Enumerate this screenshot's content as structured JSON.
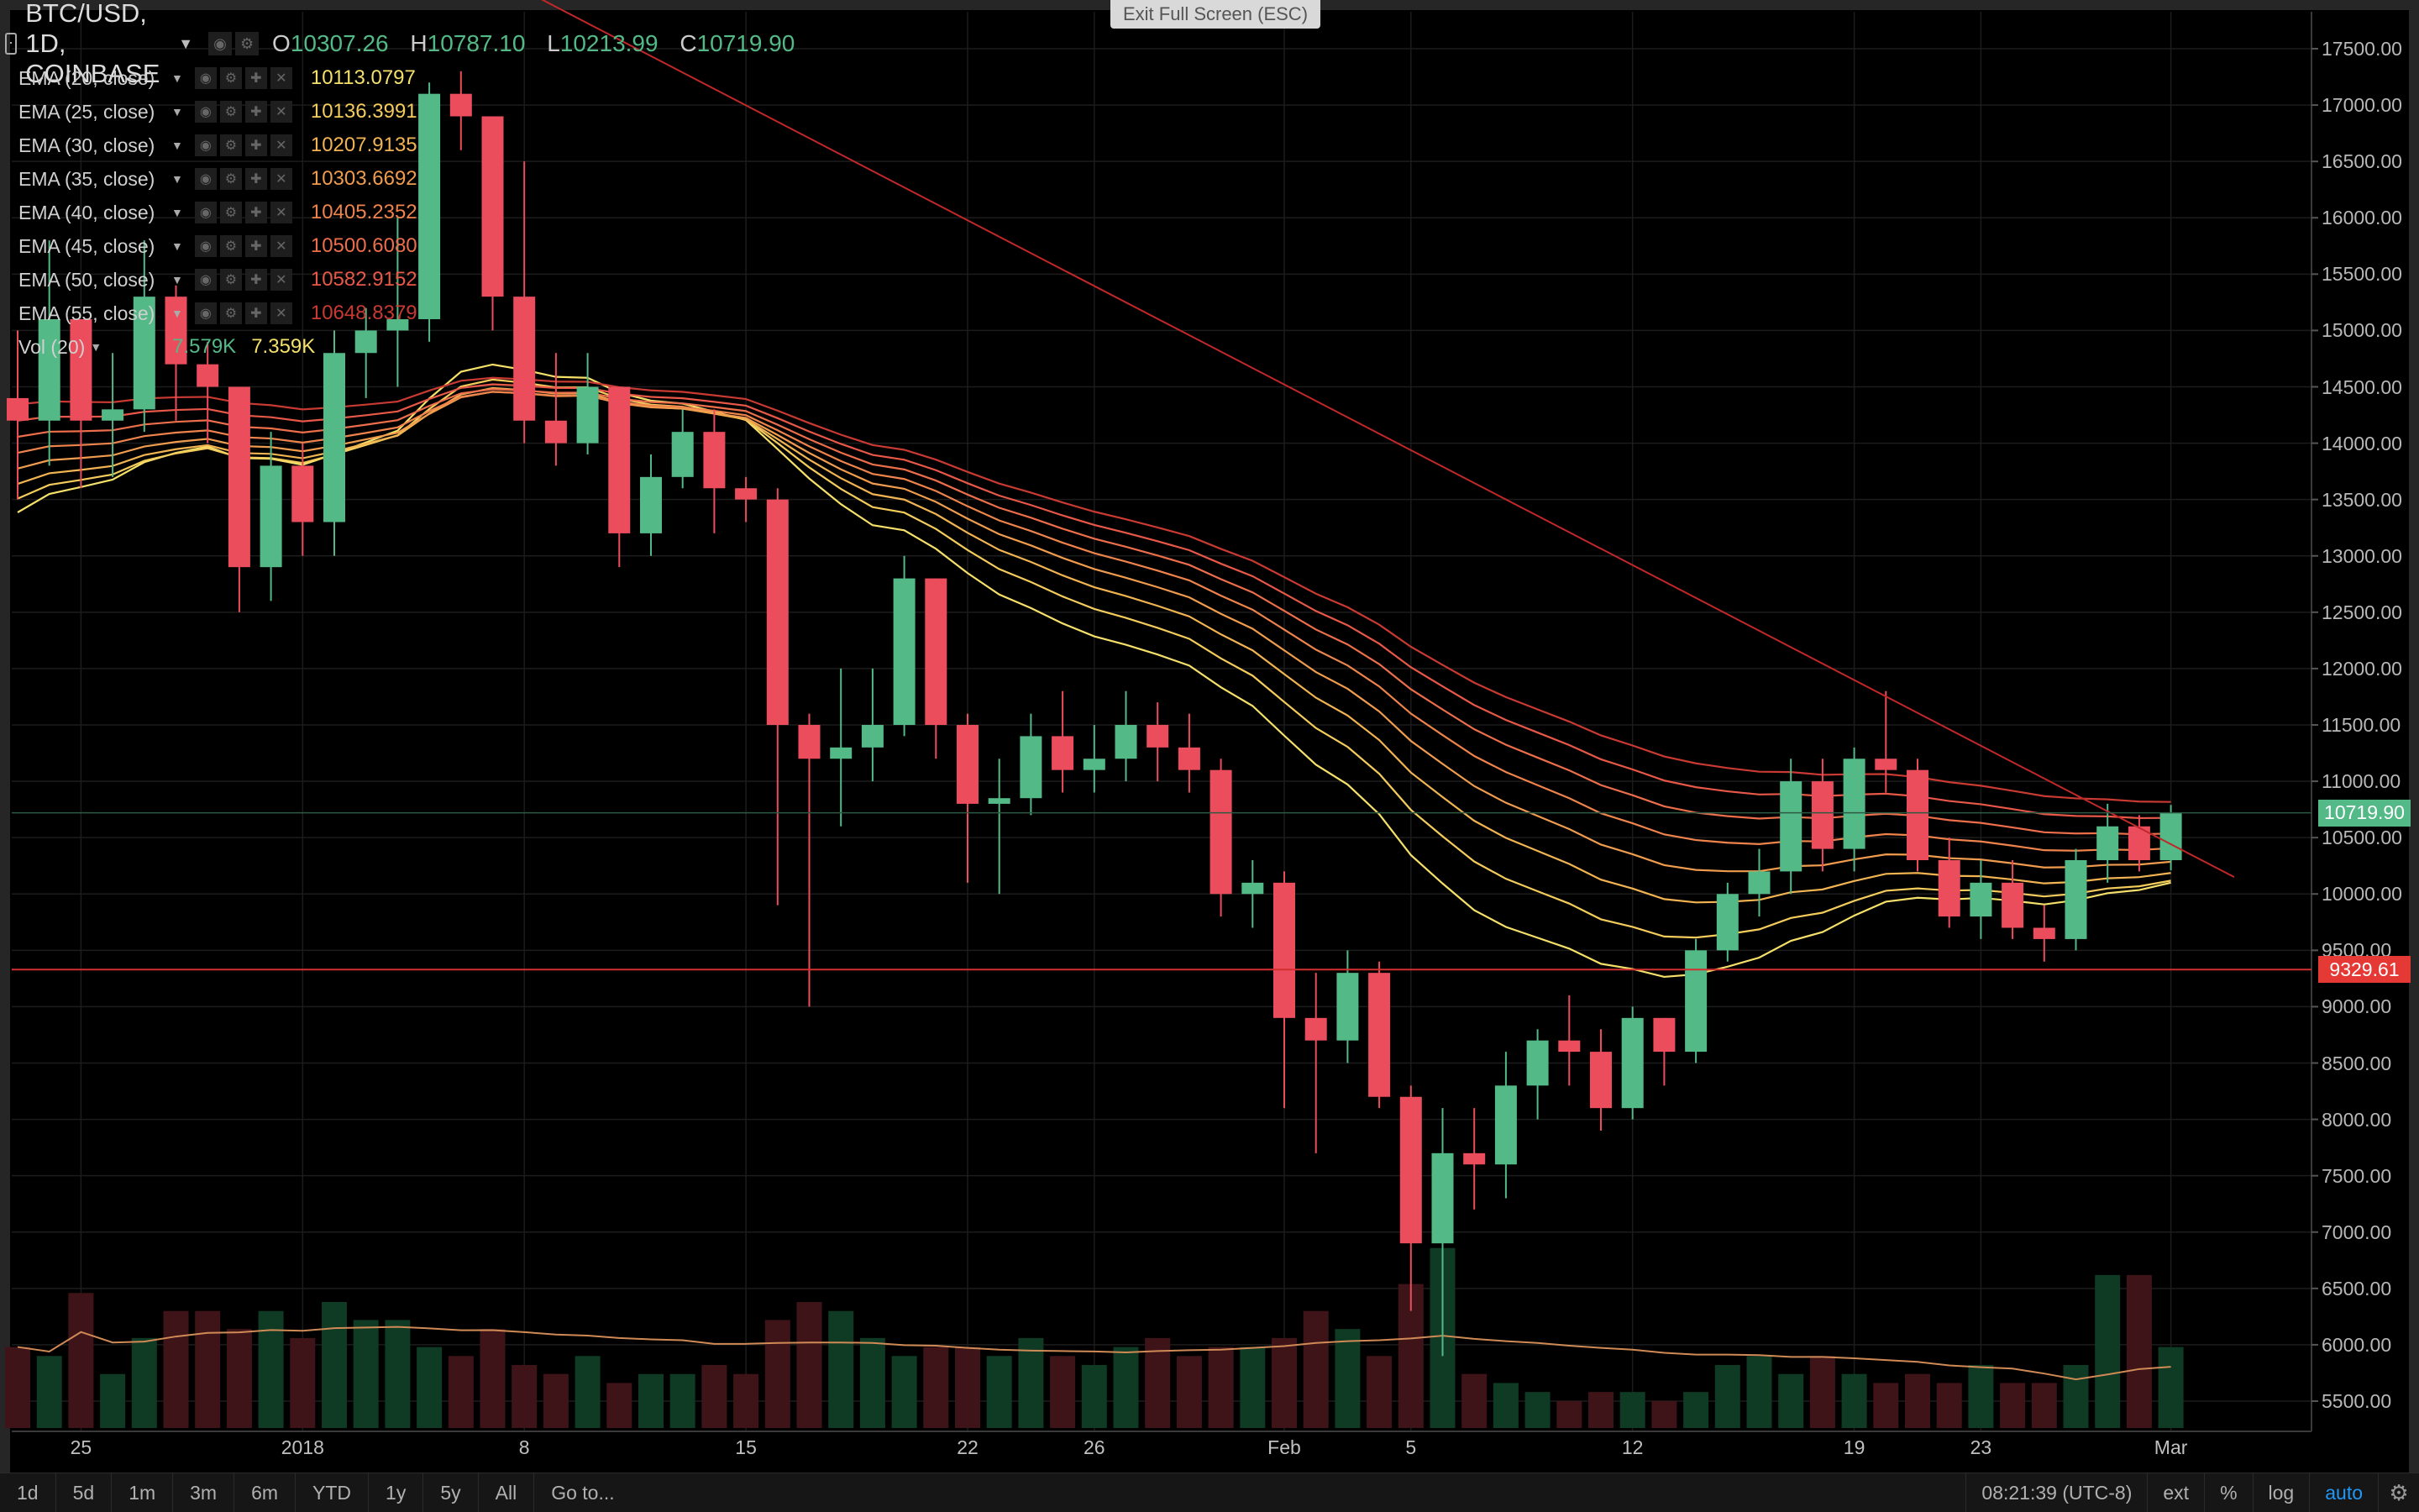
{
  "header": {
    "symbol": "BTC/USD, 1D, COINBASE",
    "ohlc": {
      "o_label": "O",
      "o": "10307.26",
      "h_label": "H",
      "h": "10787.10",
      "l_label": "L",
      "l": "10213.99",
      "c_label": "C",
      "c": "10719.90"
    }
  },
  "exit_fullscreen": "Exit Full Screen (ESC)",
  "indicators": [
    {
      "name": "EMA (20, close)",
      "value": "10113.0797",
      "color": "#f5e06a"
    },
    {
      "name": "EMA (25, close)",
      "value": "10136.3991",
      "color": "#f4cc5c"
    },
    {
      "name": "EMA (30, close)",
      "value": "10207.9135",
      "color": "#f2b452"
    },
    {
      "name": "EMA (35, close)",
      "value": "10303.6692",
      "color": "#f09c4e"
    },
    {
      "name": "EMA (40, close)",
      "value": "10405.2352",
      "color": "#ee844c"
    },
    {
      "name": "EMA (45, close)",
      "value": "10500.6080",
      "color": "#ec6e4b"
    },
    {
      "name": "EMA (50, close)",
      "value": "10582.9152",
      "color": "#e85848"
    },
    {
      "name": "EMA (55, close)",
      "value": "10648.8379",
      "color": "#c83a32"
    }
  ],
  "volume": {
    "name": "Vol (20)",
    "v1": "7.579K",
    "v2": "7.359K",
    "v1_color": "#53b987",
    "v2_color": "#f5e06a"
  },
  "price_axis": {
    "labels": [
      "17500.00",
      "17000.00",
      "16500.00",
      "16000.00",
      "15500.00",
      "15000.00",
      "14500.00",
      "14000.00",
      "13500.00",
      "13000.00",
      "12500.00",
      "12000.00",
      "11500.00",
      "11000.00",
      "10500.00",
      "10000.00",
      "9500.00",
      "9000.00",
      "8500.00",
      "8000.00",
      "7500.00",
      "7000.00",
      "6500.00",
      "6000.00",
      "5500.00"
    ],
    "last_price": "10719.90",
    "marker_price": "9329.61"
  },
  "time_axis": {
    "labels": [
      {
        "text": "25",
        "bar": 2
      },
      {
        "text": "2018",
        "bar": 9
      },
      {
        "text": "8",
        "bar": 16
      },
      {
        "text": "15",
        "bar": 23
      },
      {
        "text": "22",
        "bar": 30
      },
      {
        "text": "26",
        "bar": 34
      },
      {
        "text": "Feb",
        "bar": 40
      },
      {
        "text": "5",
        "bar": 44
      },
      {
        "text": "12",
        "bar": 51
      },
      {
        "text": "19",
        "bar": 58
      },
      {
        "text": "23",
        "bar": 62
      },
      {
        "text": "Mar",
        "bar": 68
      }
    ]
  },
  "bottom_bar": {
    "timeframes": [
      "1d",
      "5d",
      "1m",
      "3m",
      "6m",
      "YTD",
      "1y",
      "5y",
      "All"
    ],
    "goto": "Go to...",
    "time": "08:21:39 (UTC-8)",
    "ext": "ext",
    "percent": "%",
    "log": "log",
    "auto": "auto"
  },
  "colors": {
    "up": "#53b987",
    "down": "#eb4d5c",
    "trendline": "#c0282a",
    "support": "#d32f2f",
    "last_price_tag": "#53b987",
    "marker_tag": "#e53935",
    "grid": "#1c1c1c"
  },
  "chart_data": {
    "type": "candlestick",
    "price_range": [
      5000,
      17800
    ],
    "candles": [
      [
        14400,
        14200,
        15000,
        13500
      ],
      [
        14200,
        15100,
        15800,
        13800
      ],
      [
        15100,
        14200,
        14600,
        13600
      ],
      [
        14200,
        14300,
        14800,
        13700
      ],
      [
        14300,
        15300,
        15800,
        14100
      ],
      [
        15300,
        14700,
        15400,
        14200
      ],
      [
        14700,
        14500,
        14900,
        14000
      ],
      [
        14500,
        12900,
        14500,
        12500
      ],
      [
        12900,
        13800,
        14100,
        12600
      ],
      [
        13800,
        13300,
        14000,
        13000
      ],
      [
        13300,
        14800,
        15000,
        13000
      ],
      [
        14800,
        15000,
        15200,
        14400
      ],
      [
        15000,
        15100,
        16000,
        14500
      ],
      [
        15100,
        17100,
        17200,
        14900
      ],
      [
        17100,
        16900,
        17300,
        16600
      ],
      [
        16900,
        15300,
        16900,
        15000
      ],
      [
        15300,
        14200,
        16500,
        14000
      ],
      [
        14200,
        14000,
        14800,
        13800
      ],
      [
        14000,
        14500,
        14800,
        13900
      ],
      [
        14500,
        13200,
        14500,
        12900
      ],
      [
        13200,
        13700,
        13900,
        13000
      ],
      [
        13700,
        14100,
        14300,
        13600
      ],
      [
        14100,
        13600,
        14300,
        13200
      ],
      [
        13600,
        13500,
        13700,
        13300
      ],
      [
        13500,
        11500,
        13600,
        9900
      ],
      [
        11500,
        11200,
        11600,
        9000
      ],
      [
        11200,
        11300,
        12000,
        10600
      ],
      [
        11300,
        11500,
        12000,
        11000
      ],
      [
        11500,
        12800,
        13000,
        11400
      ],
      [
        12800,
        11500,
        12800,
        11200
      ],
      [
        11500,
        10800,
        11600,
        10100
      ],
      [
        10800,
        10850,
        11200,
        10000
      ],
      [
        10850,
        11400,
        11600,
        10700
      ],
      [
        11400,
        11100,
        11800,
        10900
      ],
      [
        11100,
        11200,
        11500,
        10900
      ],
      [
        11200,
        11500,
        11800,
        11000
      ],
      [
        11500,
        11300,
        11700,
        11000
      ],
      [
        11300,
        11100,
        11600,
        10900
      ],
      [
        11100,
        10000,
        11200,
        9800
      ],
      [
        10000,
        10100,
        10300,
        9700
      ],
      [
        10100,
        8900,
        10200,
        8100
      ],
      [
        8900,
        8700,
        9300,
        7700
      ],
      [
        8700,
        9300,
        9500,
        8500
      ],
      [
        9300,
        8200,
        9400,
        8100
      ],
      [
        8200,
        6900,
        8300,
        6300
      ],
      [
        6900,
        7700,
        8100,
        5900
      ],
      [
        7700,
        7600,
        8100,
        7200
      ],
      [
        7600,
        8300,
        8600,
        7300
      ],
      [
        8300,
        8700,
        8800,
        8000
      ],
      [
        8700,
        8600,
        9100,
        8300
      ],
      [
        8600,
        8100,
        8800,
        7900
      ],
      [
        8100,
        8900,
        9000,
        8000
      ],
      [
        8900,
        8600,
        8900,
        8300
      ],
      [
        8600,
        9500,
        9600,
        8500
      ],
      [
        9500,
        10000,
        10100,
        9400
      ],
      [
        10000,
        10200,
        10400,
        9800
      ],
      [
        10200,
        11000,
        11200,
        10000
      ],
      [
        11000,
        10400,
        11200,
        10200
      ],
      [
        10400,
        11200,
        11300,
        10200
      ],
      [
        11200,
        11100,
        11800,
        10900
      ],
      [
        11100,
        10300,
        11200,
        10200
      ],
      [
        10300,
        9800,
        10500,
        9700
      ],
      [
        9800,
        10100,
        10300,
        9600
      ],
      [
        10100,
        9700,
        10300,
        9600
      ],
      [
        9700,
        9600,
        9900,
        9400
      ],
      [
        9600,
        10300,
        10400,
        9500
      ],
      [
        10300,
        10600,
        10800,
        10100
      ],
      [
        10600,
        10300,
        10700,
        10200
      ],
      [
        10300,
        10720,
        10790,
        10210
      ]
    ],
    "volumes": [
      5500,
      5400,
      6100,
      5200,
      5600,
      5900,
      5900,
      5700,
      5900,
      5600,
      6000,
      5800,
      5800,
      5500,
      5400,
      5700,
      5300,
      5200,
      5400,
      5100,
      5200,
      5200,
      5300,
      5200,
      5800,
      6000,
      5900,
      5600,
      5400,
      5500,
      5500,
      5400,
      5600,
      5400,
      5300,
      5500,
      5600,
      5400,
      5500,
      5500,
      5600,
      5900,
      5700,
      5400,
      6200,
      6600,
      5200,
      5100,
      5000,
      4900,
      5000,
      5000,
      4900,
      5000,
      5300,
      5400,
      5200,
      5400,
      5200,
      5100,
      5200,
      5100,
      5300,
      5100,
      5100,
      5300,
      6300,
      6300,
      5500
    ],
    "trendline": {
      "start": {
        "bar": 12,
        "price": 18600
      },
      "end": {
        "bar": 70,
        "price": 10150
      }
    },
    "support_price": 9329.61,
    "ema_periods": [
      20,
      25,
      30,
      35,
      40,
      45,
      50,
      55
    ],
    "ema_seed": [
      13300,
      13450,
      13600,
      13750,
      13900,
      14050,
      14200,
      14350
    ]
  }
}
